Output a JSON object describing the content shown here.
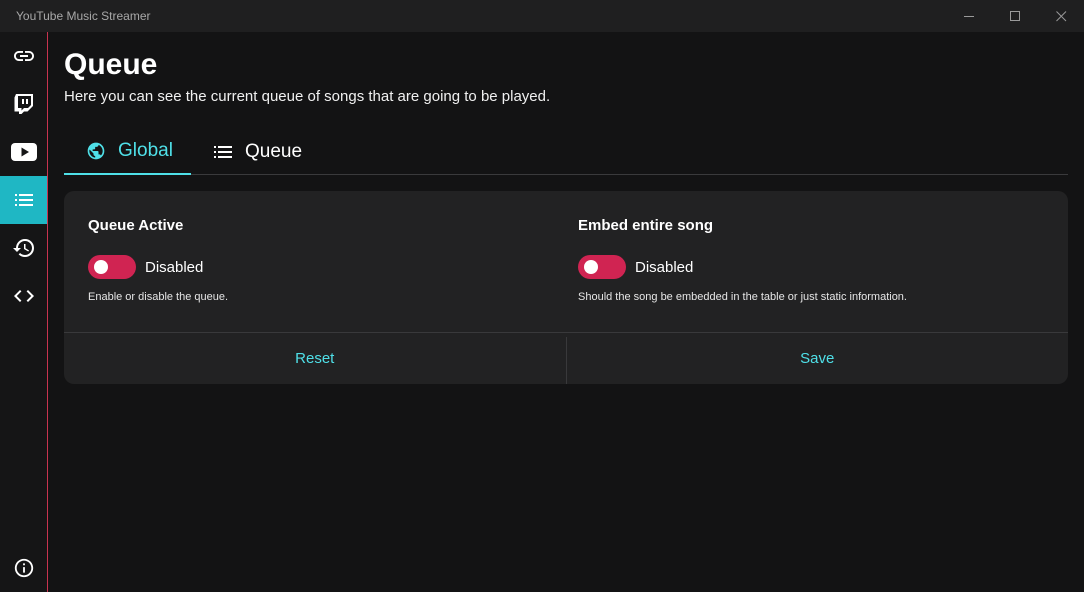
{
  "window": {
    "title": "YouTube Music Streamer"
  },
  "sidebar": {
    "items": [
      {
        "icon": "link-icon"
      },
      {
        "icon": "twitch-icon"
      },
      {
        "icon": "youtube-icon"
      },
      {
        "icon": "queue-list-icon",
        "active": true
      },
      {
        "icon": "history-icon"
      },
      {
        "icon": "code-icon"
      },
      {
        "icon": "info-icon"
      }
    ],
    "accent": "#1fb7c4",
    "border_color": "#c8334f"
  },
  "page": {
    "title": "Queue",
    "description": "Here you can see the current queue of songs that are going to be played."
  },
  "tabs": [
    {
      "label": "Global",
      "icon": "globe-icon",
      "active": true
    },
    {
      "label": "Queue",
      "icon": "list-icon",
      "active": false
    }
  ],
  "settings": {
    "queue_active": {
      "title": "Queue Active",
      "state": "Disabled",
      "help": "Enable or disable the queue."
    },
    "embed_song": {
      "title": "Embed entire song",
      "state": "Disabled",
      "help": "Should the song be embedded in the table or just static information."
    }
  },
  "footer": {
    "reset_label": "Reset",
    "save_label": "Save"
  },
  "colors": {
    "accent": "#4fe0e8",
    "toggle_off": "#d02452",
    "background": "#131314",
    "card": "#222223"
  }
}
